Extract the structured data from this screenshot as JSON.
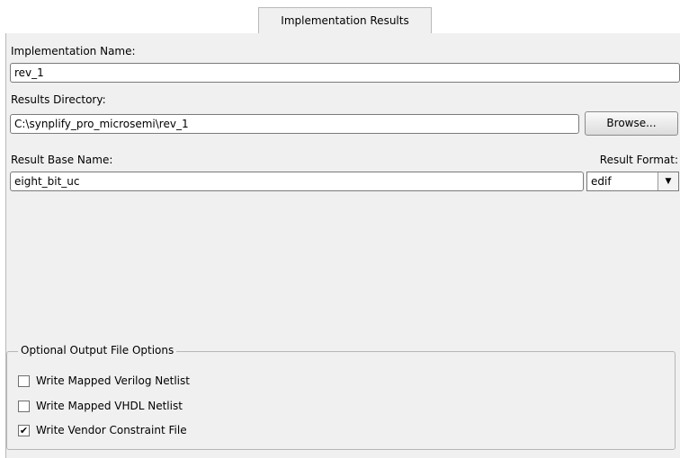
{
  "tab": {
    "label": "Implementation Results"
  },
  "implementation": {
    "label": "Implementation Name:",
    "value": "rev_1"
  },
  "results_directory": {
    "label": "Results Directory:",
    "value": "C:\\synplify_pro_microsemi\\rev_1",
    "browse_label": "Browse..."
  },
  "result_base": {
    "label": "Result Base Name:",
    "value": "eight_bit_uc"
  },
  "result_format": {
    "label": "Result Format:",
    "selected": "edif"
  },
  "optional_output": {
    "legend": "Optional Output File Options",
    "options": [
      {
        "label": "Write Mapped Verilog Netlist",
        "checked": false
      },
      {
        "label": "Write Mapped VHDL Netlist",
        "checked": false
      },
      {
        "label": "Write Vendor Constraint File",
        "checked": true
      }
    ]
  }
}
